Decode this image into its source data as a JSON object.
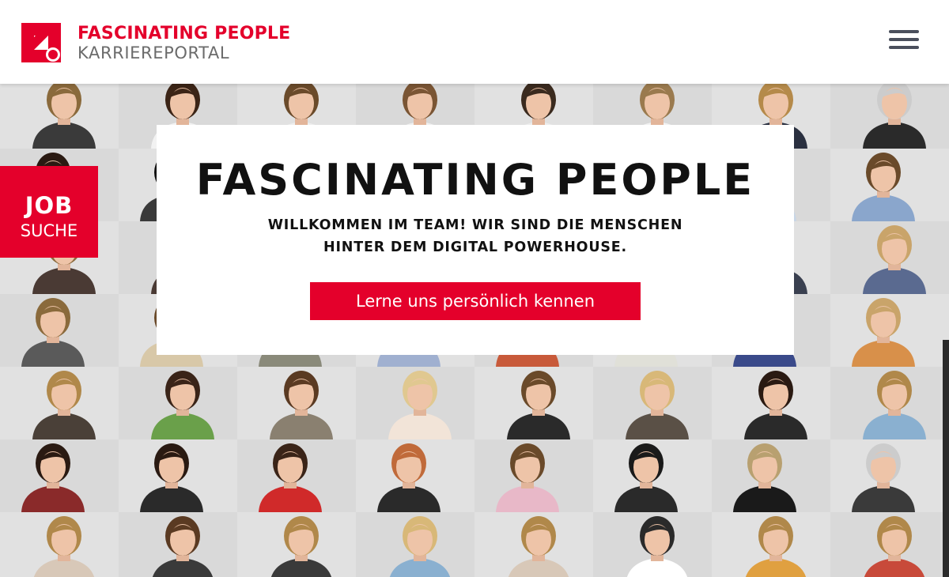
{
  "header": {
    "logo_icon": "prosieben-arrow-logo",
    "logo_title": "FASCINATING PEOPLE",
    "logo_subtitle": "KARRIEREPORTAL",
    "menu_icon": "hamburger-menu-icon"
  },
  "job_tab": {
    "line1": "JOB",
    "line2": "SUCHE"
  },
  "intro": {
    "title": "FASCINATING PEOPLE",
    "subtitle_line1": "WILLKOMMEN IM TEAM! WIR SIND DIE MENSCHEN",
    "subtitle_line2": "HINTER DEM DIGITAL POWERHOUSE.",
    "cta_label": "Lerne uns persönlich kennen"
  },
  "colors": {
    "brand_red": "#e4002b",
    "subtitle_gray": "#6b6b6b",
    "menu_gray": "#4a4f5c",
    "wall_background": "#dedede"
  },
  "people_wall": {
    "rows": 7,
    "columns": 8,
    "portraits": [
      {
        "hair": "#8a6a3c",
        "shirt": "#3a3a3a",
        "accent": "#7a8c6a"
      },
      {
        "hair": "#3b2416",
        "shirt": "#f2f2f2",
        "accent": "#dddddd"
      },
      {
        "hair": "#6a4a2a",
        "shirt": "#eeeeee",
        "accent": "#dddddd"
      },
      {
        "hair": "#7a5534",
        "shirt": "#f0f0f0",
        "accent": "#dddddd"
      },
      {
        "hair": "#3a2a1e",
        "shirt": "#ededed",
        "accent": "#dddddd"
      },
      {
        "hair": "#9a7a4e",
        "shirt": "#f2f2f2",
        "accent": "#dddddd"
      },
      {
        "hair": "#b58a4a",
        "shirt": "#2a3040",
        "accent": "#dddddd"
      },
      {
        "hair": "#cccccc",
        "shirt": "#2a2a2a",
        "accent": "#9bb0d0"
      },
      {
        "hair": "#2a1a12",
        "shirt": "#3a2a2a",
        "accent": "#dddddd"
      },
      {
        "hair": "#111111",
        "shirt": "#3a3a3a",
        "accent": "#dddddd"
      },
      {
        "hair": "#4a3a2a",
        "shirt": "#ffffff",
        "accent": "#dddddd"
      },
      {
        "hair": "#4a3a2a",
        "shirt": "#ffffff",
        "accent": "#dddddd"
      },
      {
        "hair": "#4a3a2a",
        "shirt": "#ffffff",
        "accent": "#dddddd"
      },
      {
        "hair": "#4a3a2a",
        "shirt": "#ffffff",
        "accent": "#dddddd"
      },
      {
        "hair": "#5a3a22",
        "shirt": "#c8d6e6",
        "accent": "#dddddd"
      },
      {
        "hair": "#6a4a2a",
        "shirt": "#8aa6cc",
        "accent": "#dddddd"
      },
      {
        "hair": "#8a6a3c",
        "shirt": "#4a3a34",
        "accent": "#dddddd"
      },
      {
        "hair": "#4a3420",
        "shirt": "#4a3a34",
        "accent": "#8a2a4a"
      },
      {
        "hair": "#4a3a2a",
        "shirt": "#ffffff",
        "accent": "#dddddd"
      },
      {
        "hair": "#4a3a2a",
        "shirt": "#ffffff",
        "accent": "#dddddd"
      },
      {
        "hair": "#4a3a2a",
        "shirt": "#ffffff",
        "accent": "#dddddd"
      },
      {
        "hair": "#4a3a2a",
        "shirt": "#ffffff",
        "accent": "#dddddd"
      },
      {
        "hair": "#6a4a2a",
        "shirt": "#3a4050",
        "accent": "#dddddd"
      },
      {
        "hair": "#c9a46a",
        "shirt": "#5a6a90",
        "accent": "#dddddd"
      },
      {
        "hair": "#8a6a3c",
        "shirt": "#5a5a5a",
        "accent": "#8a8a8a"
      },
      {
        "hair": "#6a4a2a",
        "shirt": "#d8c8a8",
        "accent": "#dddddd"
      },
      {
        "hair": "#6a4a2a",
        "shirt": "#8a8a7a",
        "accent": "#dddddd"
      },
      {
        "hair": "#5a3a22",
        "shirt": "#a0b0d0",
        "accent": "#dddddd"
      },
      {
        "hair": "#5a3a22",
        "shirt": "#c85a3a",
        "accent": "#dddddd"
      },
      {
        "hair": "#8a6a3c",
        "shirt": "#e0e0d8",
        "accent": "#dddddd"
      },
      {
        "hair": "#3a2418",
        "shirt": "#3a4a8a",
        "accent": "#dddddd"
      },
      {
        "hair": "#c9a46a",
        "shirt": "#d8904a",
        "accent": "#dddddd"
      },
      {
        "hair": "#b0884a",
        "shirt": "#4a4038",
        "accent": "#dddddd"
      },
      {
        "hair": "#3a2418",
        "shirt": "#6aa04a",
        "accent": "#dddddd"
      },
      {
        "hair": "#5a3a22",
        "shirt": "#8a8070",
        "accent": "#dddddd"
      },
      {
        "hair": "#e0c890",
        "shirt": "#f2e4d8",
        "accent": "#dddddd"
      },
      {
        "hair": "#6a4a2a",
        "shirt": "#2a2a2a",
        "accent": "#dddddd"
      },
      {
        "hair": "#d8b878",
        "shirt": "#5a5046",
        "accent": "#dddddd"
      },
      {
        "hair": "#2a1a12",
        "shirt": "#2a2a2a",
        "accent": "#dddddd"
      },
      {
        "hair": "#b0884a",
        "shirt": "#8ab0d0",
        "accent": "#dddddd"
      },
      {
        "hair": "#2a1a12",
        "shirt": "#8a2a2a",
        "accent": "#dddddd"
      },
      {
        "hair": "#2a1a12",
        "shirt": "#2a2a2a",
        "accent": "#dddddd"
      },
      {
        "hair": "#3a2418",
        "shirt": "#d02a2a",
        "accent": "#dddddd"
      },
      {
        "hair": "#c06a3a",
        "shirt": "#2a2a2a",
        "accent": "#dddddd"
      },
      {
        "hair": "#6a4a2a",
        "shirt": "#e8b8c8",
        "accent": "#dddddd"
      },
      {
        "hair": "#1a1a1a",
        "shirt": "#2a2a2a",
        "accent": "#d07030"
      },
      {
        "hair": "#b8a070",
        "shirt": "#1a1a1a",
        "accent": "#dddddd"
      },
      {
        "hair": "#cccccc",
        "shirt": "#3a3a3a",
        "accent": "#f0f0f0"
      },
      {
        "hair": "#b0884a",
        "shirt": "#d8c8b8",
        "accent": "#dddddd"
      },
      {
        "hair": "#5a3a22",
        "shirt": "#3a3a3a",
        "accent": "#dddddd"
      },
      {
        "hair": "#b0884a",
        "shirt": "#3a3a3a",
        "accent": "#dddddd"
      },
      {
        "hair": "#d8b878",
        "shirt": "#8ab0d0",
        "accent": "#dddddd"
      },
      {
        "hair": "#b0884a",
        "shirt": "#d8c8b8",
        "accent": "#dddddd"
      },
      {
        "hair": "#2a2a2a",
        "shirt": "#ffffff",
        "accent": "#dddddd"
      },
      {
        "hair": "#b0884a",
        "shirt": "#e0a040",
        "accent": "#dddddd"
      },
      {
        "hair": "#b0884a",
        "shirt": "#c84a3a",
        "accent": "#dddddd"
      }
    ]
  }
}
